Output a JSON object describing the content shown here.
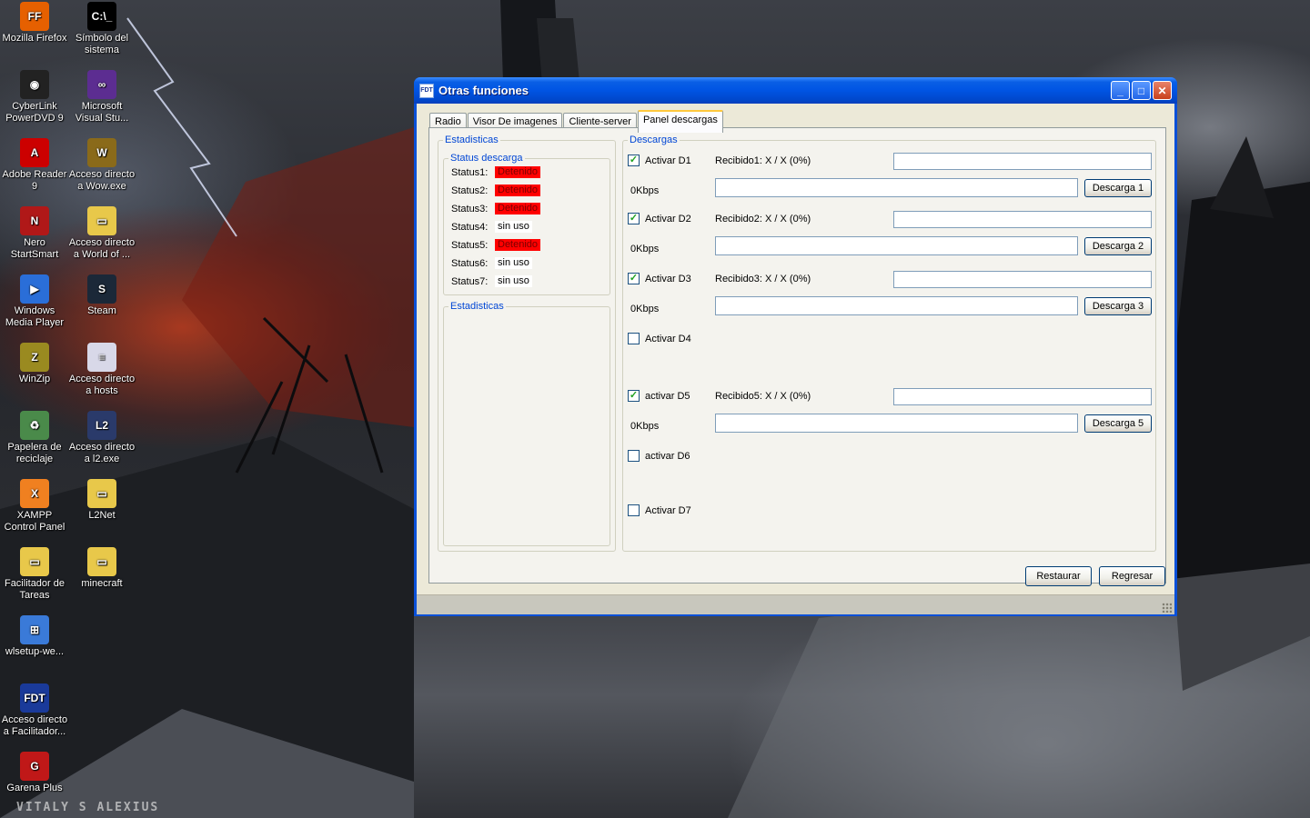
{
  "desktop": {
    "icons": [
      {
        "label": "Mozilla Firefox",
        "glyph": "FF",
        "color": "#e66000"
      },
      {
        "label": "Símbolo del sistema",
        "glyph": "C:\\_",
        "color": "#000000"
      },
      {
        "label": "CyberLink PowerDVD 9",
        "glyph": "◉",
        "color": "#222222"
      },
      {
        "label": "Microsoft Visual Stu...",
        "glyph": "∞",
        "color": "#5c2d91"
      },
      {
        "label": "Adobe Reader 9",
        "glyph": "A",
        "color": "#cc0000"
      },
      {
        "label": "Acceso directo a Wow.exe",
        "glyph": "W",
        "color": "#8a6a1a"
      },
      {
        "label": "Nero StartSmart",
        "glyph": "N",
        "color": "#b01818"
      },
      {
        "label": "Acceso directo a World of ...",
        "glyph": "▭",
        "color": "#e8c84a"
      },
      {
        "label": "Windows Media Player",
        "glyph": "▶",
        "color": "#2a6ed8"
      },
      {
        "label": "Steam",
        "glyph": "S",
        "color": "#1b2838"
      },
      {
        "label": "WinZip",
        "glyph": "Z",
        "color": "#9a8a20"
      },
      {
        "label": "Acceso directo a hosts",
        "glyph": "≡",
        "color": "#d8d8e8"
      },
      {
        "label": "Papelera de reciclaje",
        "glyph": "♻",
        "color": "#4a8a4a"
      },
      {
        "label": "Acceso directo a l2.exe",
        "glyph": "L2",
        "color": "#2a3a6a"
      },
      {
        "label": "XAMPP Control Panel",
        "glyph": "X",
        "color": "#f08020"
      },
      {
        "label": "L2Net",
        "glyph": "▭",
        "color": "#e8c84a"
      },
      {
        "label": "Facilitador de Tareas",
        "glyph": "▭",
        "color": "#e8c84a"
      },
      {
        "label": "minecraft",
        "glyph": "▭",
        "color": "#e8c84a"
      },
      {
        "label": "wlsetup-we...",
        "glyph": "⊞",
        "color": "#3a7ad8"
      },
      {
        "label": "Acceso directo a Facilitador...",
        "glyph": "FDT",
        "color": "#1a3a9a"
      },
      {
        "label": "Garena Plus",
        "glyph": "G",
        "color": "#c01818"
      }
    ],
    "watermark": "VITALY S ALEXIUS"
  },
  "window": {
    "title": "Otras funciones",
    "app_icon": "FDT",
    "controls": {
      "minimize": "_",
      "maximize": "□",
      "close": "✕"
    },
    "tabs": [
      "Radio",
      "Visor De imagenes",
      "Cliente-server",
      "Panel descargas"
    ],
    "active_tab": "Panel descargas",
    "estadisticas": {
      "title": "Estadisticas",
      "status_group": "Status descarga",
      "statuses": [
        {
          "label": "Status1:",
          "value": "Detenido",
          "state": "red"
        },
        {
          "label": "Status2:",
          "value": "Detenido",
          "state": "red"
        },
        {
          "label": "Status3:",
          "value": "Detenido",
          "state": "red"
        },
        {
          "label": "Status4:",
          "value": "sin uso",
          "state": "white"
        },
        {
          "label": "Status5:",
          "value": "Detenido",
          "state": "red"
        },
        {
          "label": "Status6:",
          "value": "sin uso",
          "state": "white"
        },
        {
          "label": "Status7:",
          "value": "sin uso",
          "state": "white"
        }
      ],
      "inner_group": "Estadisticas"
    },
    "descargas": {
      "title": "Descargas",
      "rows": [
        {
          "check": "Activar D1",
          "checked": true,
          "recibido": "Recibido1: X / X (0%)",
          "speed": "0Kbps",
          "button": "Descarga 1"
        },
        {
          "check": "Activar D2",
          "checked": true,
          "recibido": "Recibido2: X / X (0%)",
          "speed": "0Kbps",
          "button": "Descarga 2"
        },
        {
          "check": "Activar D3",
          "checked": true,
          "recibido": "Recibido3: X / X (0%)",
          "speed": "0Kbps",
          "button": "Descarga 3"
        },
        {
          "check": "Activar D4",
          "checked": false
        },
        {
          "check": "activar D5",
          "checked": true,
          "recibido": "Recibido5: X / X (0%)",
          "speed": "0Kbps",
          "button": "Descarga 5"
        },
        {
          "check": "activar D6",
          "checked": false
        },
        {
          "check": "Activar D7",
          "checked": false
        }
      ]
    },
    "buttons": {
      "restaurar": "Restaurar",
      "regresar": "Regresar"
    }
  }
}
